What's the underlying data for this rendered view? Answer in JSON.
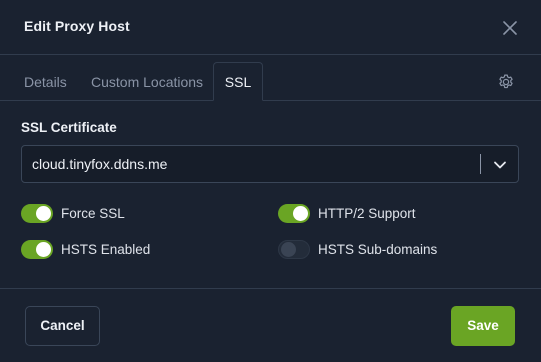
{
  "header": {
    "title": "Edit Proxy Host",
    "close_icon": "close-icon"
  },
  "tabs": [
    {
      "label": "Details",
      "active": false
    },
    {
      "label": "Custom Locations",
      "active": false
    },
    {
      "label": "SSL",
      "active": true
    }
  ],
  "settings_icon": "gear-icon",
  "ssl": {
    "certificate_label": "SSL Certificate",
    "certificate_value": "cloud.tinyfox.ddns.me",
    "options": {
      "force_ssl": {
        "label": "Force SSL",
        "enabled": true
      },
      "http2": {
        "label": "HTTP/2 Support",
        "enabled": true
      },
      "hsts": {
        "label": "HSTS Enabled",
        "enabled": true
      },
      "hsts_subdomains": {
        "label": "HSTS Sub-domains",
        "enabled": false
      }
    }
  },
  "footer": {
    "cancel_label": "Cancel",
    "save_label": "Save"
  },
  "colors": {
    "background": "#1a2230",
    "accent_green": "#6aa524",
    "border": "#313c4d",
    "muted_text": "#8a94a6"
  }
}
